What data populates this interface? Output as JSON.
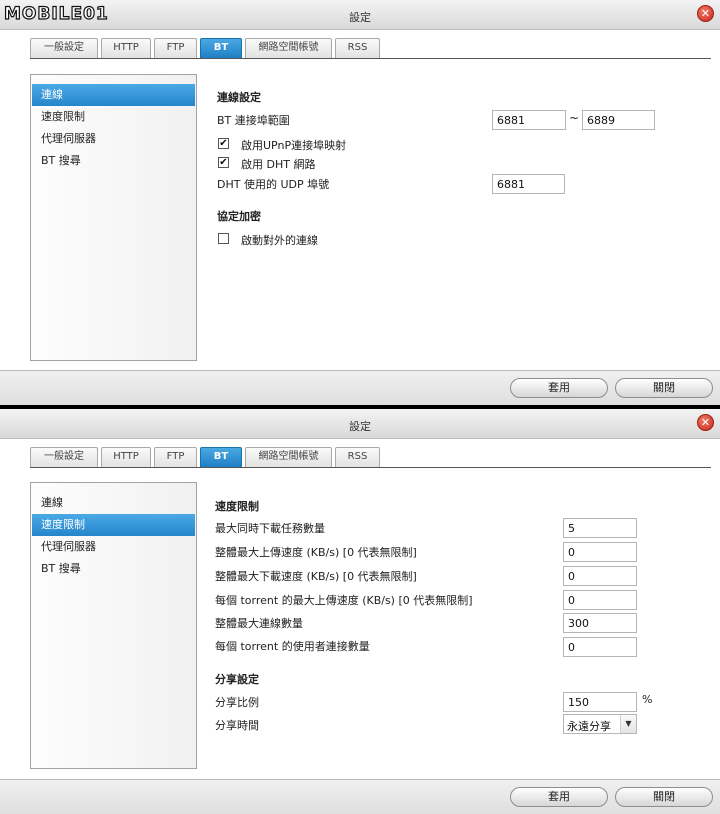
{
  "logo": {
    "text": "MOBILE01"
  },
  "dialog1": {
    "title": "設定",
    "tabs": [
      "一般設定",
      "HTTP",
      "FTP",
      "BT",
      "網路空間帳號",
      "RSS"
    ],
    "active_tab": "BT",
    "sidebar": [
      "連線",
      "速度限制",
      "代理伺服器",
      "BT 搜尋"
    ],
    "active_sidebar": "連線",
    "connection": {
      "section_title": "連線設定",
      "port_range_label": "BT 連接埠範圍",
      "port_from": "6881",
      "tilde": "~",
      "port_to": "6889",
      "upnp_label": "啟用UPnP連接埠映射",
      "upnp_checked": true,
      "dht_label": "啟用 DHT 網路",
      "dht_checked": true,
      "dht_port_label": "DHT 使用的 UDP 埠號",
      "dht_port": "6881"
    },
    "encryption": {
      "section_title": "協定加密",
      "outgoing_label": "啟動對外的連線",
      "outgoing_checked": false
    },
    "buttons": {
      "apply": "套用",
      "close": "關閉"
    }
  },
  "dialog2": {
    "title": "設定",
    "tabs": [
      "一般設定",
      "HTTP",
      "FTP",
      "BT",
      "網路空間帳號",
      "RSS"
    ],
    "active_tab": "BT",
    "sidebar": [
      "連線",
      "速度限制",
      "代理伺服器",
      "BT 搜尋"
    ],
    "active_sidebar": "速度限制",
    "speed": {
      "section_title": "速度限制",
      "rows": [
        {
          "label": "最大同時下載任務數量",
          "value": "5"
        },
        {
          "label": "整體最大上傳速度 (KB/s) [0 代表無限制]",
          "value": "0"
        },
        {
          "label": "整體最大下載速度 (KB/s) [0 代表無限制]",
          "value": "0"
        },
        {
          "label": "每個 torrent 的最大上傳速度 (KB/s) [0 代表無限制]",
          "value": "0"
        },
        {
          "label": "整體最大連線數量",
          "value": "300"
        },
        {
          "label": "每個 torrent 的使用者連接數量",
          "value": "0"
        }
      ]
    },
    "sharing": {
      "section_title": "分享設定",
      "ratio_label": "分享比例",
      "ratio_value": "150",
      "ratio_unit": "%",
      "time_label": "分享時間",
      "time_value": "永遠分享"
    },
    "buttons": {
      "apply": "套用",
      "close": "關閉"
    }
  },
  "icons": {
    "close": "close-icon",
    "dropdown": "chevron-down-icon",
    "check": "check-icon"
  }
}
